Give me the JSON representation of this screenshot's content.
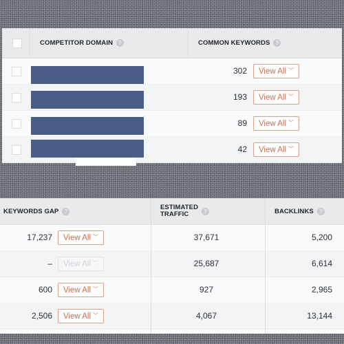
{
  "top_table": {
    "headers": {
      "domain": "COMPETITOR DOMAIN",
      "common_keywords": "COMMON KEYWORDS"
    },
    "rows": [
      {
        "domain": "[redacted]",
        "common_keywords": "302",
        "action": "View All"
      },
      {
        "domain": "[redacted]",
        "common_keywords": "193",
        "action": "View All"
      },
      {
        "domain": "[redacted]",
        "common_keywords": "89",
        "action": "View All"
      },
      {
        "domain": "[redacted]",
        "common_keywords": "42",
        "action": "View All"
      }
    ]
  },
  "bottom_table": {
    "headers": {
      "keywords_gap": "KEYWORDS GAP",
      "estimated_traffic_line1": "ESTIMATED",
      "estimated_traffic_line2": "TRAFFIC",
      "backlinks": "BACKLINKS"
    },
    "rows": [
      {
        "keywords_gap": "17,237",
        "action": "View All",
        "action_enabled": true,
        "estimated_traffic": "37,671",
        "backlinks": "5,200"
      },
      {
        "keywords_gap": "–",
        "action": "View All",
        "action_enabled": false,
        "estimated_traffic": "25,687",
        "backlinks": "6,614"
      },
      {
        "keywords_gap": "600",
        "action": "View All",
        "action_enabled": true,
        "estimated_traffic": "927",
        "backlinks": "2,965"
      },
      {
        "keywords_gap": "2,506",
        "action": "View All",
        "action_enabled": true,
        "estimated_traffic": "4,067",
        "backlinks": "13,144"
      }
    ]
  },
  "icons": {
    "help": "?",
    "chevron": "﹀"
  },
  "colors": {
    "redaction_bar": "#475d85",
    "accent_button": "#c9714f",
    "header_bg": "#e9eaeb"
  }
}
